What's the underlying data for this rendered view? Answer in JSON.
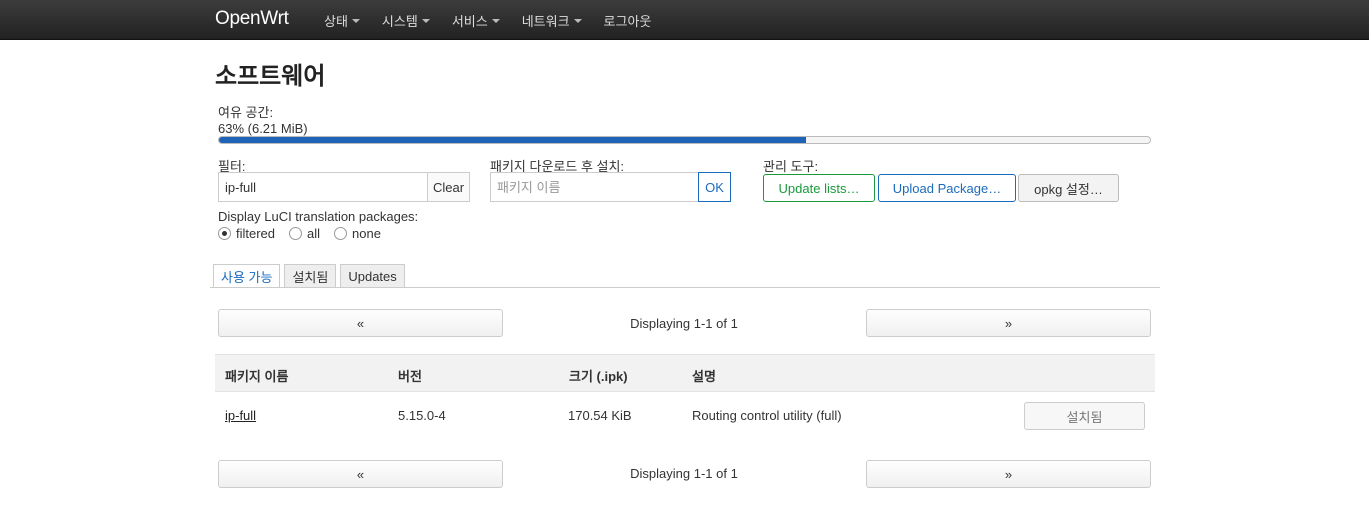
{
  "brand": "OpenWrt",
  "nav": [
    "상태",
    "시스템",
    "서비스",
    "네트워크",
    "로그아웃"
  ],
  "page_title": "소프트웨어",
  "free_space": {
    "label": "여유 공간:",
    "text": "63% (6.21 MiB)",
    "percent": 63
  },
  "filter": {
    "label": "필터:",
    "value": "ip-full",
    "clear_label": "Clear"
  },
  "download": {
    "label": "패키지 다운로드 후 설치:",
    "placeholder": "패키지 이름",
    "ok_label": "OK"
  },
  "admin": {
    "label": "관리 도구:",
    "update_label": "Update lists…",
    "upload_label": "Upload Package…",
    "opkg_label": "opkg 설정…"
  },
  "translation": {
    "label": "Display LuCI translation packages:",
    "options": [
      "filtered",
      "all",
      "none"
    ],
    "selected": "filtered"
  },
  "tabs": [
    "사용 가능",
    "설치됨",
    "Updates"
  ],
  "pager": {
    "prev": "«",
    "next": "»",
    "text": "Displaying 1-1 of 1"
  },
  "table": {
    "headers": [
      "패키지 이름",
      "버전",
      "크기 (.ipk)",
      "설명"
    ],
    "rows": [
      {
        "name": "ip-full",
        "version": "5.15.0-4",
        "size": "170.54 KiB",
        "description": "Routing control utility (full)",
        "action": "설치됨"
      }
    ]
  }
}
